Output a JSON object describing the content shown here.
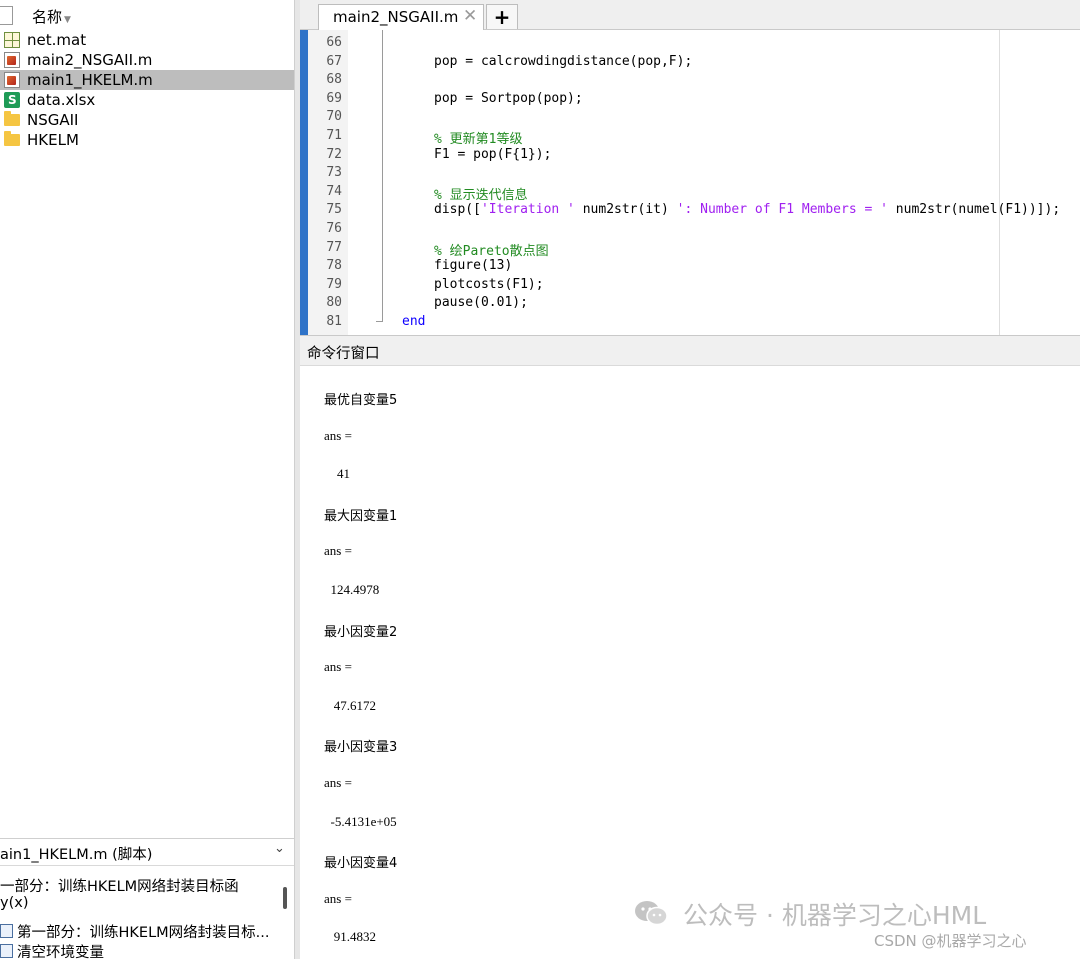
{
  "file_browser": {
    "header_label": "名称",
    "items": [
      {
        "label": "net.mat",
        "icon": "mat-file-icon"
      },
      {
        "label": "main2_NSGAII.m",
        "icon": "m-script-icon"
      },
      {
        "label": "main1_HKELM.m",
        "icon": "m-script-icon",
        "selected": true
      },
      {
        "label": "data.xlsx",
        "icon": "xlsx-file-icon"
      },
      {
        "label": "NSGAII",
        "icon": "folder-icon"
      },
      {
        "label": "HKELM",
        "icon": "folder-icon"
      }
    ]
  },
  "details": {
    "title": "ain1_HKELM.m  (脚本)",
    "line1": "一部分：训练HKELM网络封装目标函",
    "line2": "y(x)",
    "line3": "第一部分：训练HKELM网络封装目标...",
    "line4": "清空环境变量"
  },
  "editor": {
    "tab_label": "main2_NSGAII.m",
    "tab_close": "✕",
    "tab_add": "+",
    "lines": [
      {
        "n": "66",
        "tokens": []
      },
      {
        "n": "67",
        "tokens": [
          {
            "t": "pop = calcrowdingdistance(pop,F);",
            "c": ""
          }
        ]
      },
      {
        "n": "68",
        "tokens": []
      },
      {
        "n": "69",
        "tokens": [
          {
            "t": "pop = Sortpop(pop);",
            "c": ""
          }
        ]
      },
      {
        "n": "70",
        "tokens": []
      },
      {
        "n": "71",
        "tokens": [
          {
            "t": "% 更新第1等级",
            "c": "cmt"
          }
        ]
      },
      {
        "n": "72",
        "tokens": [
          {
            "t": "F1 = pop(F{1});",
            "c": ""
          }
        ]
      },
      {
        "n": "73",
        "tokens": []
      },
      {
        "n": "74",
        "tokens": [
          {
            "t": "% 显示迭代信息",
            "c": "cmt"
          }
        ]
      },
      {
        "n": "75",
        "tokens": [
          {
            "t": "disp([",
            "c": ""
          },
          {
            "t": "'Iteration '",
            "c": "str"
          },
          {
            "t": " num2str(it) ",
            "c": ""
          },
          {
            "t": "': Number of F1 Members = '",
            "c": "str"
          },
          {
            "t": " num2str(numel(F1))]);",
            "c": ""
          }
        ]
      },
      {
        "n": "76",
        "tokens": []
      },
      {
        "n": "77",
        "tokens": [
          {
            "t": "% 绘Pareto散点图",
            "c": "cmt"
          }
        ]
      },
      {
        "n": "78",
        "tokens": [
          {
            "t": "figure(13)",
            "c": ""
          }
        ]
      },
      {
        "n": "79",
        "tokens": [
          {
            "t": "plotcosts(F1);",
            "c": ""
          }
        ]
      },
      {
        "n": "80",
        "tokens": [
          {
            "t": "pause(0.01);",
            "c": ""
          }
        ]
      },
      {
        "n": "81",
        "tokens": [
          {
            "t": "end",
            "c": "kw"
          }
        ],
        "outdent": true
      }
    ]
  },
  "command_window": {
    "title": "命令行窗口",
    "output": [
      {
        "text": "最优自变量5",
        "cn": true
      },
      {
        "text": "ans ="
      },
      {
        "text": "    41"
      },
      {
        "text": "最大因变量1",
        "cn": true
      },
      {
        "text": "ans ="
      },
      {
        "text": "  124.4978"
      },
      {
        "text": "最小因变量2",
        "cn": true
      },
      {
        "text": "ans ="
      },
      {
        "text": "   47.6172"
      },
      {
        "text": "最小因变量3",
        "cn": true
      },
      {
        "text": "ans ="
      },
      {
        "text": "  -5.4131e+05"
      },
      {
        "text": "最小因变量4",
        "cn": true
      },
      {
        "text": "ans ="
      },
      {
        "text": "   91.4832"
      }
    ]
  },
  "watermark": {
    "main": "公众号 · 机器学习之心HML",
    "sub": "CSDN @机器学习之心"
  }
}
